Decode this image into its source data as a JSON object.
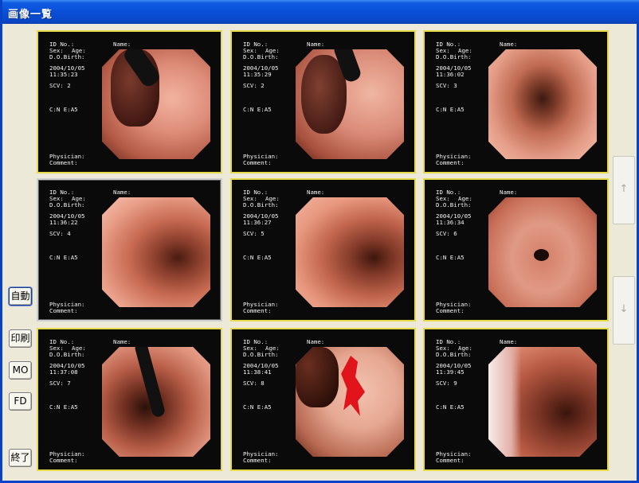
{
  "window": {
    "title": "画像一覧"
  },
  "labels": {
    "id": "ID No.:",
    "name": "Name:",
    "sex": "Sex:",
    "age": "Age:",
    "dob": "D.O.Birth:",
    "physician": "Physician:",
    "comment": "Comment:"
  },
  "tiles": [
    {
      "date": "2004/10/05",
      "time": "11:35:23",
      "scv": "SCV: 2",
      "code": "C:N E:A5",
      "selected": false
    },
    {
      "date": "2004/10/05",
      "time": "11:35:29",
      "scv": "SCV: 2",
      "code": "C:N E:A5",
      "selected": false
    },
    {
      "date": "2004/10/05",
      "time": "11:36:02",
      "scv": "SCV: 3",
      "code": "C:N E:A5",
      "selected": false
    },
    {
      "date": "2004/10/05",
      "time": "11:36:22",
      "scv": "SCV: 4",
      "code": "C:N E:A5",
      "selected": true
    },
    {
      "date": "2004/10/05",
      "time": "11:36:27",
      "scv": "SCV: 5",
      "code": "C:N E:A5",
      "selected": false
    },
    {
      "date": "2004/10/05",
      "time": "11:36:34",
      "scv": "SCV: 6",
      "code": "C:N E:A5",
      "selected": false
    },
    {
      "date": "2004/10/05",
      "time": "11:37:08",
      "scv": "SCV: 7",
      "code": "C:N E:A5",
      "selected": false
    },
    {
      "date": "2004/10/05",
      "time": "11:38:41",
      "scv": "SCV: 8",
      "code": "C:N E:A5",
      "selected": false
    },
    {
      "date": "2004/10/05",
      "time": "11:39:45",
      "scv": "SCV: 9",
      "code": "C:N E:A5",
      "selected": false
    }
  ],
  "buttons": {
    "auto": "自動",
    "print": "印刷",
    "mo": "MO",
    "fd": "FD",
    "exit": "終了",
    "scroll_up": "↑",
    "scroll_down": "↓"
  },
  "icons": {
    "scroll_up": "up-arrow-icon",
    "scroll_down": "down-arrow-icon"
  },
  "colors": {
    "tile_border": "#e6d94a",
    "title_bar": "#0a4fd8",
    "window_bg": "#ece9d8"
  }
}
